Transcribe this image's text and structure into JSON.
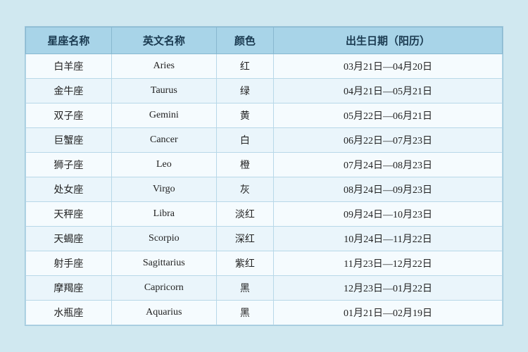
{
  "table": {
    "headers": {
      "col1": "星座名称",
      "col2": "英文名称",
      "col3": "颜色",
      "col4": "出生日期（阳历）"
    },
    "rows": [
      {
        "cn": "白羊座",
        "en": "Aries",
        "color": "红",
        "date": "03月21日—04月20日"
      },
      {
        "cn": "金牛座",
        "en": "Taurus",
        "color": "绿",
        "date": "04月21日—05月21日"
      },
      {
        "cn": "双子座",
        "en": "Gemini",
        "color": "黄",
        "date": "05月22日—06月21日"
      },
      {
        "cn": "巨蟹座",
        "en": "Cancer",
        "color": "白",
        "date": "06月22日—07月23日"
      },
      {
        "cn": "狮子座",
        "en": "Leo",
        "color": "橙",
        "date": "07月24日—08月23日"
      },
      {
        "cn": "处女座",
        "en": "Virgo",
        "color": "灰",
        "date": "08月24日—09月23日"
      },
      {
        "cn": "天秤座",
        "en": "Libra",
        "color": "淡红",
        "date": "09月24日—10月23日"
      },
      {
        "cn": "天蝎座",
        "en": "Scorpio",
        "color": "深红",
        "date": "10月24日—11月22日"
      },
      {
        "cn": "射手座",
        "en": "Sagittarius",
        "color": "紫红",
        "date": "11月23日—12月22日"
      },
      {
        "cn": "摩羯座",
        "en": "Capricorn",
        "color": "黑",
        "date": "12月23日—01月22日"
      },
      {
        "cn": "水瓶座",
        "en": "Aquarius",
        "color": "黑",
        "date": "01月21日—02月19日"
      }
    ]
  }
}
